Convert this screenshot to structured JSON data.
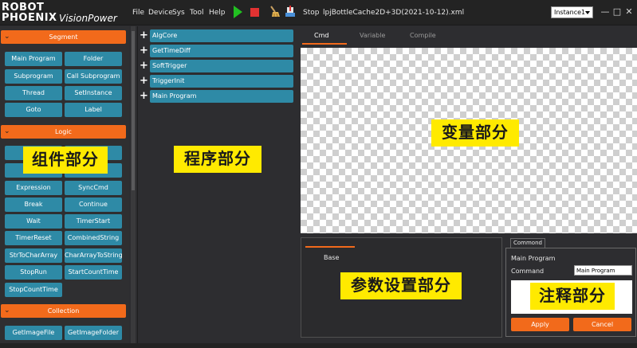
{
  "titlebar": {
    "logo": {
      "line1": "ROBOT",
      "line2": "PHOENIX",
      "product": "VisionPower"
    },
    "menus": [
      "File",
      "Device",
      "Sys",
      "Tool",
      "Help"
    ],
    "tools": {
      "run_icon": "play-icon",
      "stop_icon": "stop-icon",
      "clear_icon": "broom-icon",
      "export_icon": "export-icon"
    },
    "stop_label": "Stop",
    "file_name": "lpjBottleCache2D+3D(2021-10-12).xml",
    "instance": "Instance1",
    "window_buttons": [
      "—",
      "□",
      "✕"
    ]
  },
  "palette": {
    "segment": {
      "title": "Segment",
      "items": [
        "Main Program",
        "Folder",
        "Subprogram",
        "Call Subprogram",
        "Thread",
        "SetInstance",
        "Goto",
        "Label"
      ]
    },
    "logic": {
      "title": "Logic",
      "items": [
        "",
        "",
        "",
        "",
        "Expression",
        "SyncCmd",
        "Break",
        "Continue",
        "Wait",
        "TimerStart",
        "TimerReset",
        "CombinedString",
        "StrToCharArray",
        "CharArrayToString",
        "StopRun",
        "StartCountTime",
        "StopCountTime"
      ]
    },
    "collection": {
      "title": "Collection",
      "items": [
        "GetImageFile",
        "GetImageFolder"
      ]
    }
  },
  "program": {
    "items": [
      "AlgCore",
      "GetTimeDiff",
      "SoftTrigger",
      "TriggerInit",
      "Main Program"
    ]
  },
  "variables": {
    "tabs": [
      "Cmd",
      "Variable",
      "Compile"
    ],
    "active_tab": "Cmd"
  },
  "params": {
    "tab": "Base"
  },
  "comment": {
    "tab": "Commond",
    "title": "Main Program",
    "command_label": "Command",
    "command_value": "Main Program",
    "apply_label": "Apply",
    "cancel_label": "Cancel"
  },
  "annotations": {
    "components": "组件部分",
    "program": "程序部分",
    "variables": "变量部分",
    "params": "参数设置部分",
    "comment": "注释部分"
  },
  "colors": {
    "accent": "#f26a1b",
    "item": "#2e8aa6",
    "annotation": "#ffea00",
    "background": "#2d2d30"
  }
}
